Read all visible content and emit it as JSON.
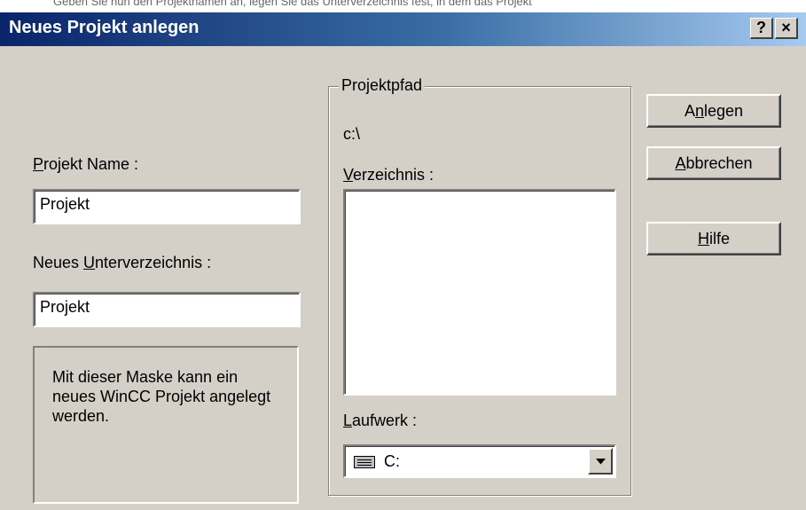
{
  "top_strip_text": "Geben Sie nun den Projektnamen an, legen Sie das Unterverzeichnis fest, in dem das Projekt",
  "window": {
    "title": "Neues Projekt anlegen",
    "help_label": "?",
    "close_label": "×"
  },
  "form": {
    "project_name": {
      "label_mnemonic": "P",
      "label_rest": "rojekt Name :",
      "value": "Projekt"
    },
    "subdirectory": {
      "label_pre": "Neues ",
      "label_mnemonic": "U",
      "label_rest": "nterverzeichnis :",
      "value": "Projekt"
    },
    "info_text": "Mit dieser Maske kann ein neues WinCC Projekt angelegt werden."
  },
  "project_path": {
    "group_title": "Projektpfad",
    "current_path": "c:\\",
    "directory_label_mnemonic": "V",
    "directory_label_rest": "erzeichnis :",
    "drive_label_mnemonic": "L",
    "drive_label_rest": "aufwerk :",
    "drive_value": "C:"
  },
  "buttons": {
    "create": {
      "pre": "A",
      "mnemonic": "n",
      "rest": "legen"
    },
    "cancel": {
      "pre": "",
      "mnemonic": "A",
      "rest": "bbrechen"
    },
    "help": {
      "pre": "",
      "mnemonic": "H",
      "rest": "ilfe"
    }
  },
  "colors": {
    "dialog_bg": "#d4d0c8",
    "titlebar_start": "#0a246a",
    "titlebar_end": "#a6caf0"
  },
  "icons": [
    "help-icon",
    "close-icon",
    "drive-icon",
    "chevron-down-icon"
  ]
}
